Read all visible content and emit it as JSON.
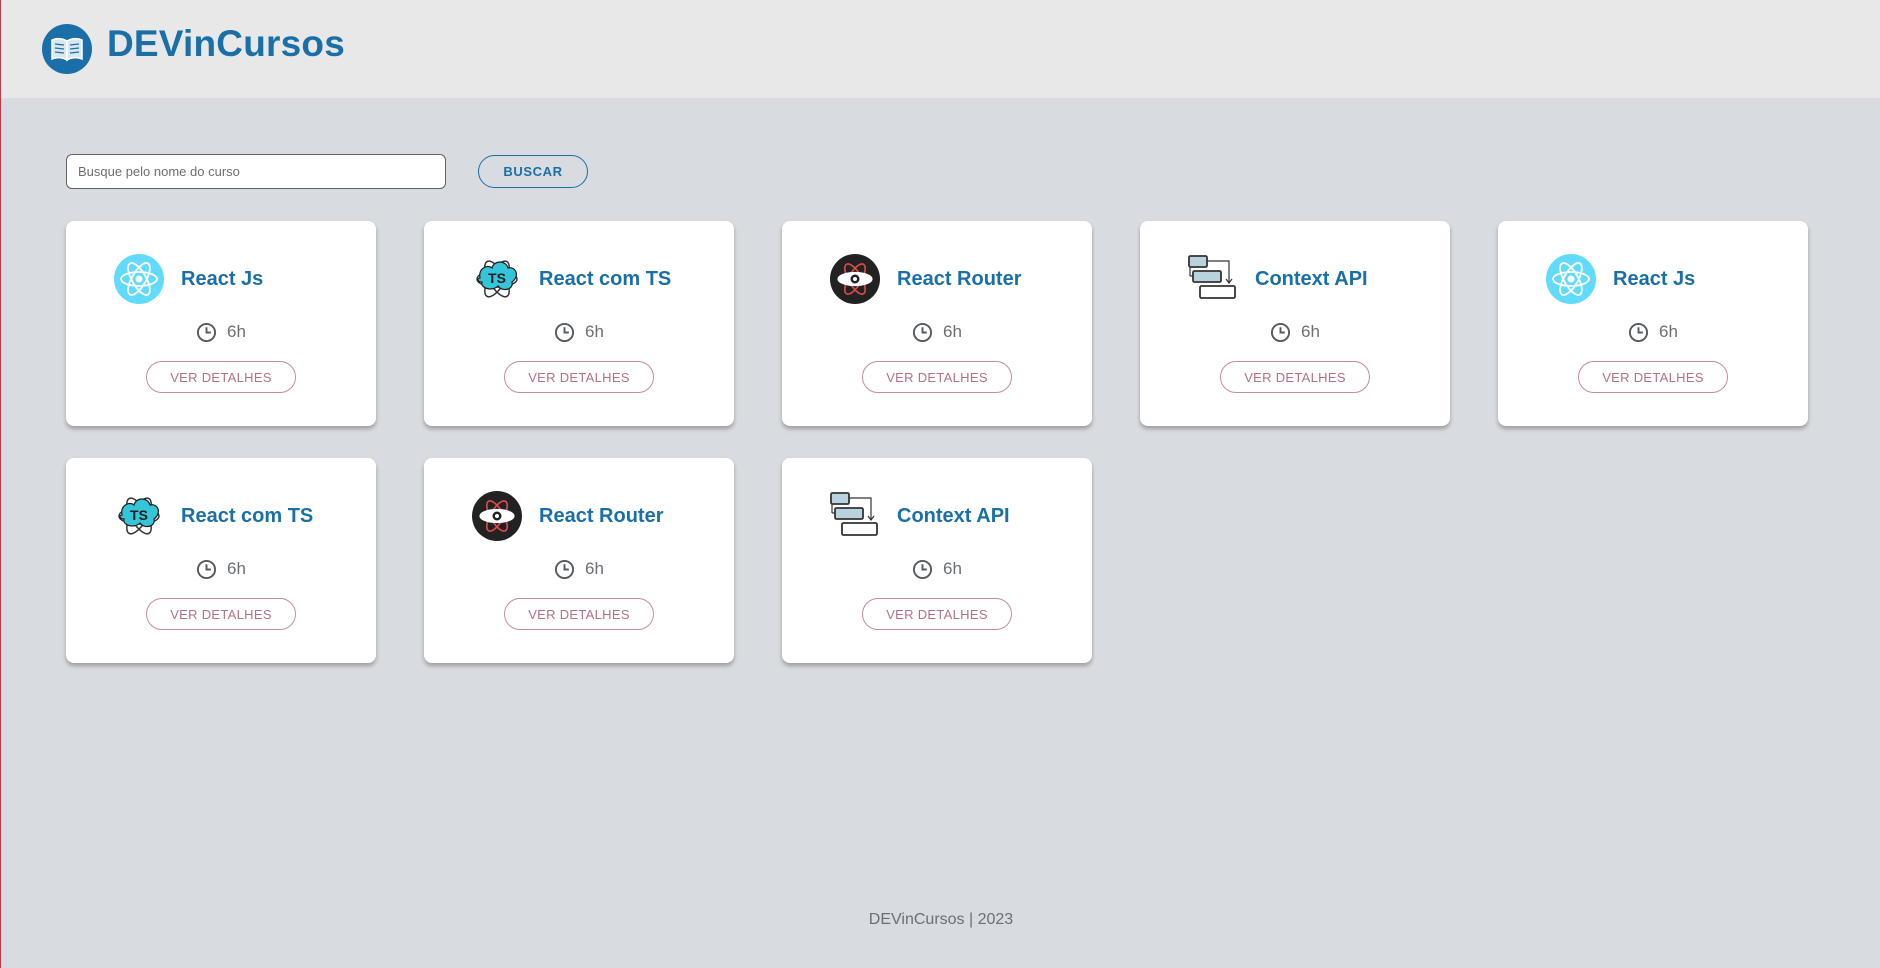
{
  "header": {
    "title": "DEVinCursos",
    "logo_icon": "open-book-icon",
    "brand_color": "#1a6fa8"
  },
  "search": {
    "placeholder": "Busque pelo nome do curso",
    "value": "",
    "button_label": "BUSCAR"
  },
  "courses": [
    {
      "title": "React Js",
      "icon": "react-icon",
      "duration": "6h",
      "button_label": "VER DETALHES"
    },
    {
      "title": "React com TS",
      "icon": "react-typescript-icon",
      "duration": "6h",
      "button_label": "VER DETALHES"
    },
    {
      "title": "React Router",
      "icon": "react-router-icon",
      "duration": "6h",
      "button_label": "VER DETALHES"
    },
    {
      "title": "Context API",
      "icon": "context-api-icon",
      "duration": "6h",
      "button_label": "VER DETALHES"
    },
    {
      "title": "React Js",
      "icon": "react-icon",
      "duration": "6h",
      "button_label": "VER DETALHES"
    },
    {
      "title": "React com TS",
      "icon": "react-typescript-icon",
      "duration": "6h",
      "button_label": "VER DETALHES"
    },
    {
      "title": "React Router",
      "icon": "react-router-icon",
      "duration": "6h",
      "button_label": "VER DETALHES"
    },
    {
      "title": "Context API",
      "icon": "context-api-icon",
      "duration": "6h",
      "button_label": "VER DETALHES"
    }
  ],
  "footer": {
    "text": "DEVinCursos | 2023"
  }
}
